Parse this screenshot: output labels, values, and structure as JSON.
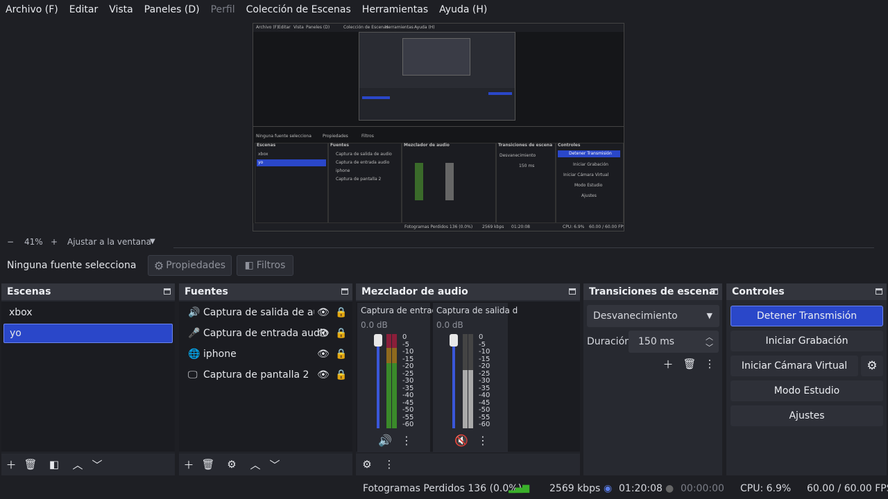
{
  "menu": [
    "Archivo (F)",
    "Editar",
    "Vista",
    "Paneles (D)",
    "Perfil",
    "Colección de Escenas",
    "Herramientas",
    "Ayuda (H)"
  ],
  "zoom": {
    "minus": "−",
    "value": "41%",
    "plus": "+",
    "fit": "Ajustar a la ventana"
  },
  "source_bar": {
    "status": "Ninguna fuente selecciona",
    "properties": "Propiedades",
    "filters": "Filtros"
  },
  "scenes": {
    "title": "Escenas",
    "items": [
      "xbox",
      "yo"
    ],
    "selected": 1
  },
  "sources": {
    "title": "Fuentes",
    "items": [
      {
        "icon": "speaker-icon",
        "label": "Captura de salida de audio"
      },
      {
        "icon": "microphone-icon",
        "label": "Captura de entrada audio"
      },
      {
        "icon": "globe-icon",
        "label": "iphone"
      },
      {
        "icon": "monitor-icon",
        "label": "Captura de pantalla 2"
      }
    ]
  },
  "mixer": {
    "title": "Mezclador de audio",
    "channels": [
      {
        "name": "Captura de entrada",
        "db": "0.0 dB",
        "muted": false
      },
      {
        "name": "Captura de salida d",
        "db": "0.0 dB",
        "muted": true
      }
    ],
    "scale": [
      "0",
      "-5",
      "-10",
      "-15",
      "-20",
      "-25",
      "-30",
      "-35",
      "-40",
      "-45",
      "-50",
      "-55",
      "-60"
    ]
  },
  "transitions": {
    "title": "Transiciones de escena",
    "selected": "Desvanecimiento",
    "duration_label": "Duración",
    "duration": "150 ms"
  },
  "controls": {
    "title": "Controles",
    "buttons": [
      "Detener Transmisión",
      "Iniciar Grabación",
      "Iniciar Cámara Virtual",
      "Modo Estudio",
      "Ajustes"
    ]
  },
  "status": {
    "dropped": "Fotogramas Perdidos 136 (0.0%)",
    "bitrate": "2569 kbps",
    "stream_time": "01:20:08",
    "rec_time": "00:00:00",
    "cpu": "CPU: 6.9%",
    "fps": "60.00 / 60.00 FPS"
  },
  "colors": {
    "accent": "#2a47c9",
    "selected_border": "#6c86ef",
    "bg": "#1e1f24",
    "panel": "#272930"
  }
}
